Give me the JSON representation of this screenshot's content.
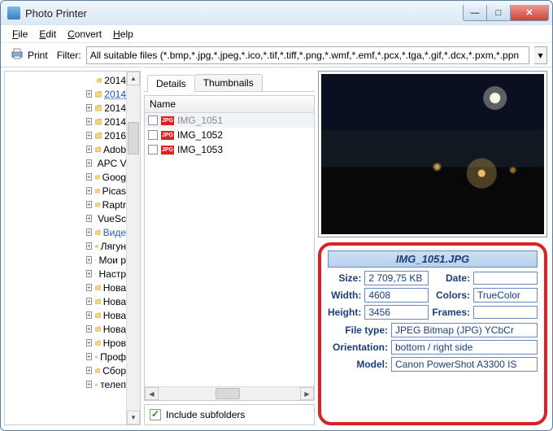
{
  "window": {
    "title": "Photo Printer"
  },
  "menu": {
    "file": "File",
    "edit": "Edit",
    "convert": "Convert",
    "help": "Help"
  },
  "toolbar": {
    "print_label": "Print",
    "filter_label": "Filter:",
    "filter_value": "All suitable files (*.bmp,*.jpg,*.jpeg,*.ico,*.tif,*.tiff,*.png,*.wmf,*.emf,*.pcx,*.tga,*.gif,*.dcx,*.pxm,*.ppn"
  },
  "tree": {
    "items": [
      {
        "label": "2014",
        "selected": false
      },
      {
        "label": "2014",
        "selected": true
      },
      {
        "label": "2014",
        "selected": false
      },
      {
        "label": "2014",
        "selected": false
      },
      {
        "label": "2016",
        "selected": false
      },
      {
        "label": "Adob",
        "selected": false
      },
      {
        "label": "APC V",
        "selected": false
      },
      {
        "label": "Goog",
        "selected": false
      },
      {
        "label": "Picas",
        "selected": false
      },
      {
        "label": "Raptr",
        "selected": false
      },
      {
        "label": "VueSc",
        "selected": false
      },
      {
        "label": "Виде",
        "selected": false,
        "dashed": true
      },
      {
        "label": "Лягун",
        "selected": false
      },
      {
        "label": "Мои р",
        "selected": false
      },
      {
        "label": "Настр",
        "selected": false
      },
      {
        "label": "Нова",
        "selected": false
      },
      {
        "label": "Нова",
        "selected": false
      },
      {
        "label": "Нова",
        "selected": false
      },
      {
        "label": "Нова",
        "selected": false
      },
      {
        "label": "Нров",
        "selected": false
      },
      {
        "label": "Проф",
        "selected": false
      },
      {
        "label": "Сбор",
        "selected": false
      },
      {
        "label": "телеп",
        "selected": false
      }
    ]
  },
  "tabs": {
    "details": "Details",
    "thumbnails": "Thumbnails"
  },
  "list": {
    "header": "Name",
    "items": [
      {
        "name": "IMG_1051",
        "selected": true
      },
      {
        "name": "IMG_1052",
        "selected": false
      },
      {
        "name": "IMG_1053",
        "selected": false
      }
    ]
  },
  "include_label": "Include subfolders",
  "info": {
    "filename": "IMG_1051.JPG",
    "labels": {
      "size": "Size:",
      "date": "Date:",
      "width": "Width:",
      "colors": "Colors:",
      "height": "Height:",
      "frames": "Frames:",
      "filetype": "File type:",
      "orientation": "Orientation:",
      "model": "Model:"
    },
    "values": {
      "size": "2 709,75 KB",
      "date": "",
      "width": "4608",
      "colors": "TrueColor",
      "height": "3456",
      "frames": "",
      "filetype": "JPEG Bitmap (JPG) YCbCr",
      "orientation": "bottom / right side",
      "model": "Canon PowerShot A3300 IS"
    }
  }
}
